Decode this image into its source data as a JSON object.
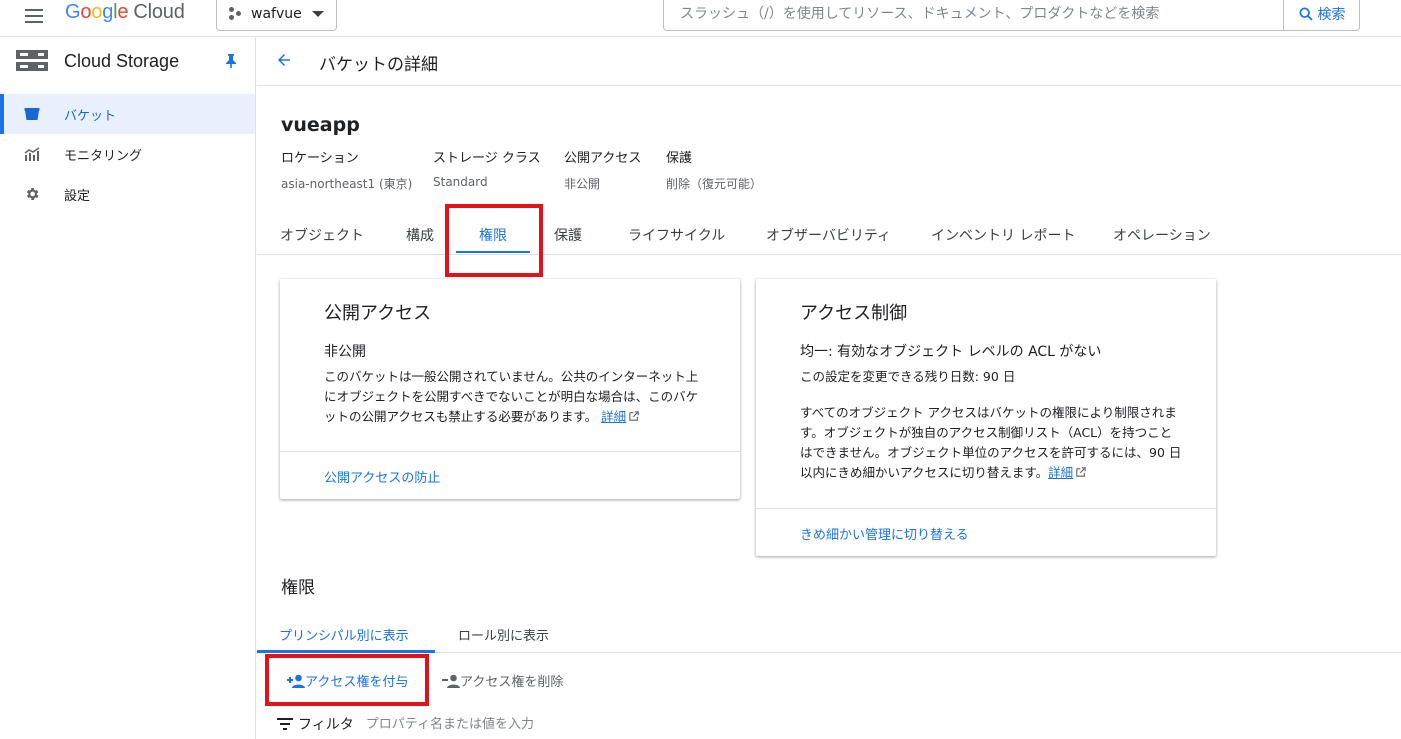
{
  "topbar": {
    "logo_google": "Google",
    "logo_cloud": "Cloud",
    "project_name": "wafvue",
    "search_placeholder": "スラッシュ（/）を使用してリソース、ドキュメント、プロダクトなどを検索",
    "search_button": "検索"
  },
  "sidebar": {
    "title": "Cloud Storage",
    "items": [
      {
        "label": "バケット",
        "icon": "bucket-icon",
        "active": true
      },
      {
        "label": "モニタリング",
        "icon": "monitoring-icon",
        "active": false
      },
      {
        "label": "設定",
        "icon": "gear-icon",
        "active": false
      }
    ]
  },
  "page": {
    "title": "バケットの詳細",
    "bucket_name": "vueapp",
    "meta": [
      {
        "key": "ロケーション",
        "value": "asia-northeast1 (東京)"
      },
      {
        "key": "ストレージ クラス",
        "value": "Standard"
      },
      {
        "key": "公開アクセス",
        "value": "非公開"
      },
      {
        "key": "保護",
        "value": "削除（復元可能）"
      }
    ],
    "tabs": [
      "オブジェクト",
      "構成",
      "権限",
      "保護",
      "ライフサイクル",
      "オブザーバビリティ",
      "インベントリ レポート",
      "オペレーション"
    ],
    "active_tab": "権限"
  },
  "public_access_card": {
    "title": "公開アクセス",
    "status": "非公開",
    "text_line1": "このバケットは一般公開されていません。公共のインターネット上",
    "text_line2": "にオブジェクトを公開すべきでないことが明白な場合は、このバケ",
    "text_line3": "ットの公開アクセスも禁止する必要があります。",
    "link": "詳細",
    "action": "公開アクセスの防止"
  },
  "access_control_card": {
    "title": "アクセス制御",
    "status": "均一: 有効なオブジェクト レベルの ACL がない",
    "days_left": "この設定を変更できる残り日数: 90 日",
    "text_line1": "すべてのオブジェクト アクセスはバケットの権限により制限されま",
    "text_line2": "す。オブジェクトが独自のアクセス制御リスト（ACL）を持つこと",
    "text_line3": "はできません。オブジェクト単位のアクセスを許可するには、90 日",
    "text_line4": "以内にきめ細かいアクセスに切り替えます。",
    "link": "詳細",
    "action": "きめ細かい管理に切り替える"
  },
  "permissions": {
    "title": "権限",
    "subtabs": [
      "プリンシパル別に表示",
      "ロール別に表示"
    ],
    "grant_button": "アクセス権を付与",
    "remove_button": "アクセス権を削除",
    "filter_label": "フィルタ",
    "filter_placeholder": "プロパティ名または値を入力"
  },
  "colors": {
    "accent": "#1a73e8",
    "highlight": "#e3111a",
    "active_bg": "#e8f0fe"
  }
}
